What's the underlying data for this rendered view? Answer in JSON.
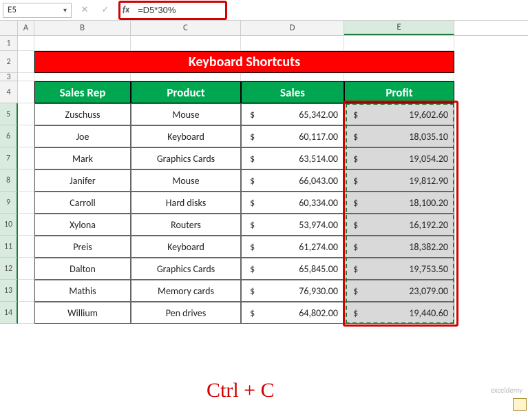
{
  "name_box": "E5",
  "formula_bar": {
    "fx_label": "fx",
    "value": "=D5*30%",
    "cancel_icon": "✕",
    "enter_icon": "✓"
  },
  "col_headers": {
    "A": "A",
    "B": "B",
    "C": "C",
    "D": "D",
    "E": "E"
  },
  "row_numbers": [
    "1",
    "2",
    "3",
    "4",
    "5",
    "6",
    "7",
    "8",
    "9",
    "10",
    "11",
    "12",
    "13",
    "14"
  ],
  "title": "Keyboard Shortcuts",
  "table_headers": {
    "rep": "Sales Rep",
    "product": "Product",
    "sales": "Sales",
    "profit": "Profit"
  },
  "currency": "$",
  "rows": [
    {
      "rep": "Zuschuss",
      "product": "Mouse",
      "sales": "65,342.00",
      "profit": "19,602.60"
    },
    {
      "rep": "Joe",
      "product": "Keyboard",
      "sales": "60,117.00",
      "profit": "18,035.10"
    },
    {
      "rep": "Mark",
      "product": "Graphics Cards",
      "sales": "63,514.00",
      "profit": "19,054.20"
    },
    {
      "rep": "Janifer",
      "product": "Mouse",
      "sales": "66,043.00",
      "profit": "19,812.90"
    },
    {
      "rep": "Carroll",
      "product": "Hard disks",
      "sales": "60,334.00",
      "profit": "18,100.20"
    },
    {
      "rep": "Xylona",
      "product": "Routers",
      "sales": "53,974.00",
      "profit": "16,192.20"
    },
    {
      "rep": "Preis",
      "product": "Keyboard",
      "sales": "61,274.00",
      "profit": "18,382.20"
    },
    {
      "rep": "Dalton",
      "product": "Graphics Cards",
      "sales": "65,845.00",
      "profit": "19,753.50"
    },
    {
      "rep": "Mathis",
      "product": "Memory cards",
      "sales": "76,930.00",
      "profit": "23,079.00"
    },
    {
      "rep": "Willium",
      "product": "Pen drives",
      "sales": "64,802.00",
      "profit": "19,440.60"
    }
  ],
  "shortcut_text": "Ctrl + C",
  "watermark": "exceldemy"
}
